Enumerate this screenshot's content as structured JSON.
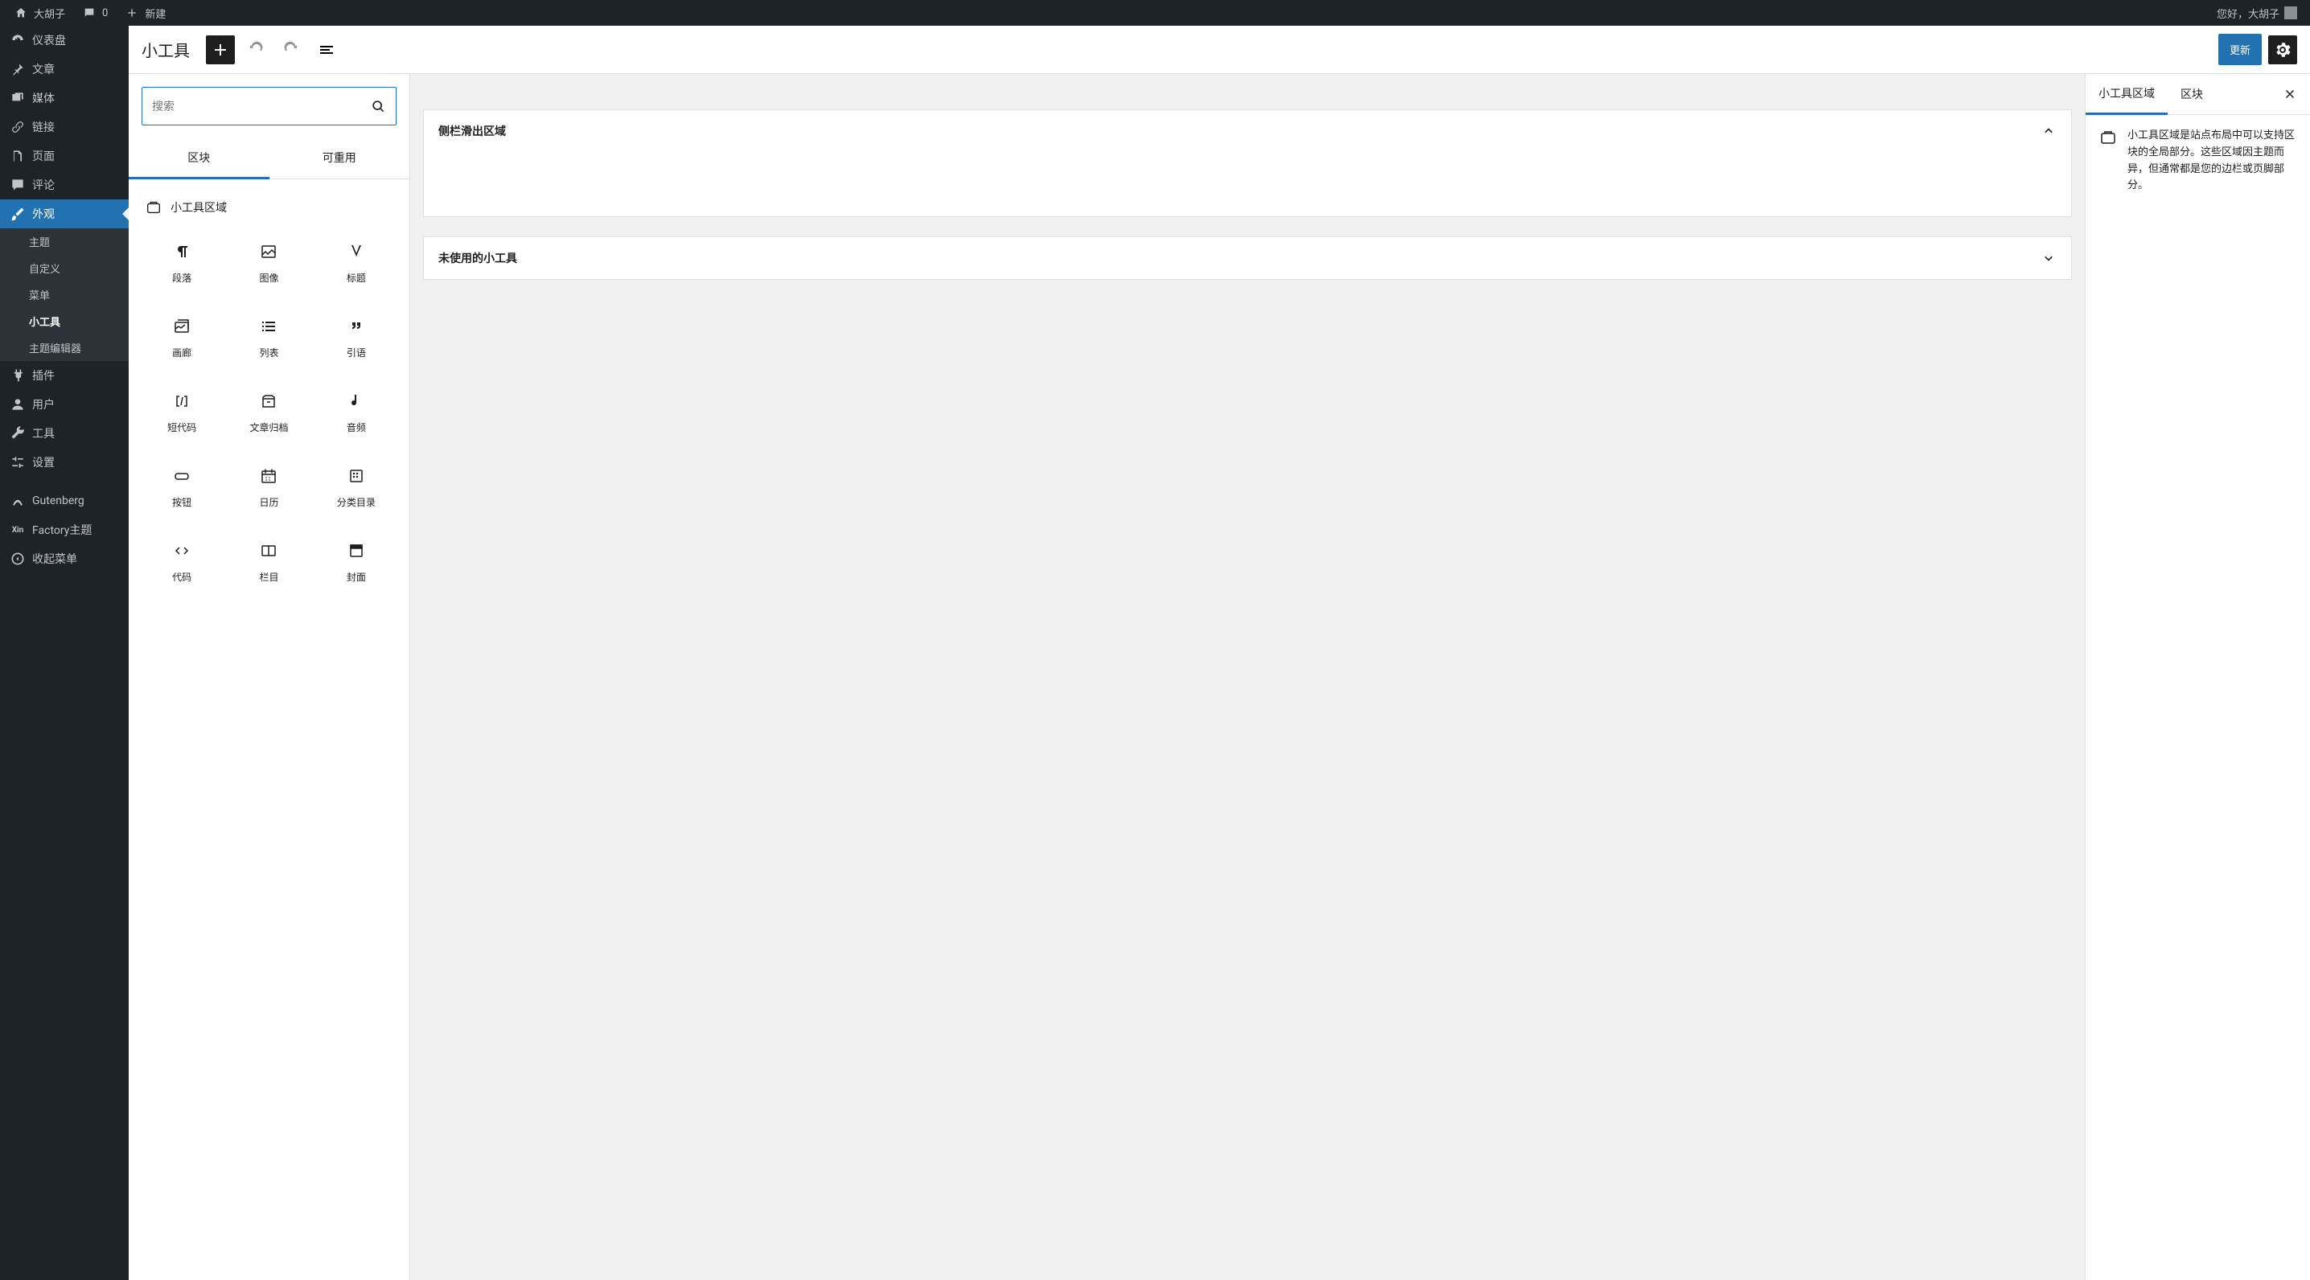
{
  "topbar": {
    "site_name": "大胡子",
    "comments_count": "0",
    "new_label": "新建",
    "greeting": "您好，大胡子"
  },
  "admin_menu": {
    "dashboard": "仪表盘",
    "posts": "文章",
    "media": "媒体",
    "links": "链接",
    "pages": "页面",
    "comments": "评论",
    "appearance": "外观",
    "appearance_sub": {
      "themes": "主题",
      "customize": "自定义",
      "menus": "菜单",
      "widgets": "小工具",
      "theme_editor": "主题编辑器"
    },
    "plugins": "插件",
    "users": "用户",
    "tools": "工具",
    "settings": "设置",
    "gutenberg": "Gutenberg",
    "factory": "Factory主题",
    "collapse": "收起菜单"
  },
  "editor": {
    "title": "小工具",
    "update_button": "更新"
  },
  "inserter": {
    "search_placeholder": "搜索",
    "tab_blocks": "区块",
    "tab_reusable": "可重用",
    "category_title": "小工具区域",
    "blocks": [
      {
        "label": "段落",
        "icon": "paragraph"
      },
      {
        "label": "图像",
        "icon": "image"
      },
      {
        "label": "标题",
        "icon": "heading"
      },
      {
        "label": "画廊",
        "icon": "gallery"
      },
      {
        "label": "列表",
        "icon": "list"
      },
      {
        "label": "引语",
        "icon": "quote"
      },
      {
        "label": "短代码",
        "icon": "shortcode"
      },
      {
        "label": "文章归档",
        "icon": "archive"
      },
      {
        "label": "音频",
        "icon": "audio"
      },
      {
        "label": "按钮",
        "icon": "button"
      },
      {
        "label": "日历",
        "icon": "calendar"
      },
      {
        "label": "分类目录",
        "icon": "categories"
      },
      {
        "label": "代码",
        "icon": "code"
      },
      {
        "label": "栏目",
        "icon": "columns"
      },
      {
        "label": "封面",
        "icon": "cover"
      }
    ]
  },
  "canvas": {
    "area1_title": "侧栏滑出区域",
    "area2_title": "未使用的小工具"
  },
  "settings": {
    "tab_area": "小工具区域",
    "tab_block": "区块",
    "description": "小工具区域是站点布局中可以支持区块的全局部分。这些区域因主题而异，但通常都是您的边栏或页脚部分。"
  }
}
